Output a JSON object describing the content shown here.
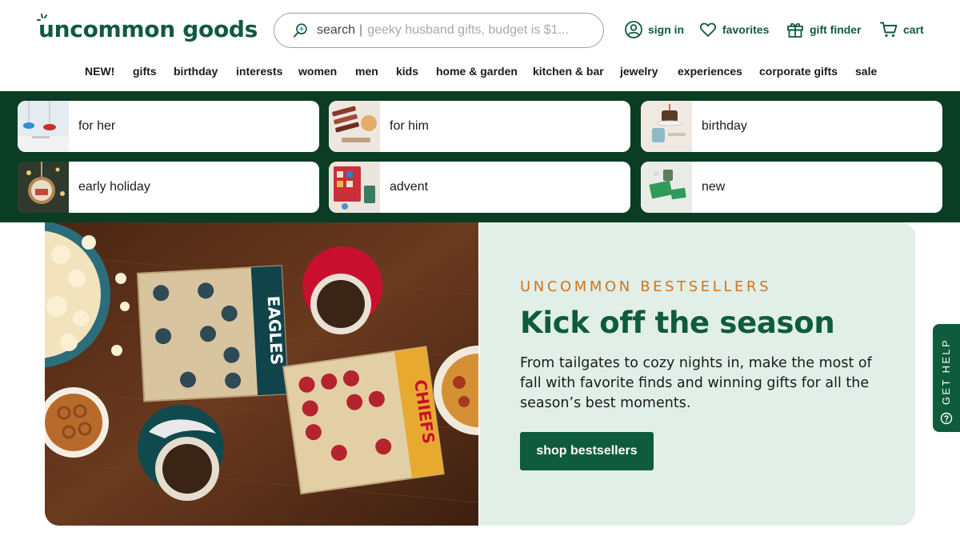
{
  "header": {
    "logo_text": "uncommon goods",
    "search": {
      "label": "search",
      "separator": "|",
      "placeholder": "geeky husband gifts, budget is $1..."
    },
    "utility": [
      {
        "label": "sign in",
        "icon": "user-circle-icon"
      },
      {
        "label": "favorites",
        "icon": "heart-icon"
      },
      {
        "label": "gift finder",
        "icon": "gift-icon"
      },
      {
        "label": "cart",
        "icon": "cart-icon"
      }
    ]
  },
  "nav": {
    "items": [
      "NEW!",
      "gifts",
      "birthday",
      "interests",
      "women",
      "men",
      "kids",
      "home & garden",
      "kitchen & bar",
      "jewelry",
      "experiences",
      "corporate gifts",
      "sale"
    ]
  },
  "categories": [
    {
      "label": "for her"
    },
    {
      "label": "for him"
    },
    {
      "label": "birthday"
    },
    {
      "label": "early holiday"
    },
    {
      "label": "advent"
    },
    {
      "label": "new"
    }
  ],
  "hero": {
    "eyebrow": "UNCOMMON BESTSELLERS",
    "headline": "Kick off the season",
    "body": "From tailgates to cozy nights in, make the most of fall with favorite finds and winning gifts for all the season’s best moments.",
    "cta": "shop bestsellers",
    "image": {
      "board_left_team": "EAGLES",
      "board_right_team": "CHIEFS"
    }
  },
  "help_tab": {
    "label": "GET HELP"
  },
  "colors": {
    "brand_green": "#0f5b3d",
    "band_green": "#0b3d24",
    "accent_orange": "#d4741c",
    "panel_mint": "#e1efe8"
  }
}
